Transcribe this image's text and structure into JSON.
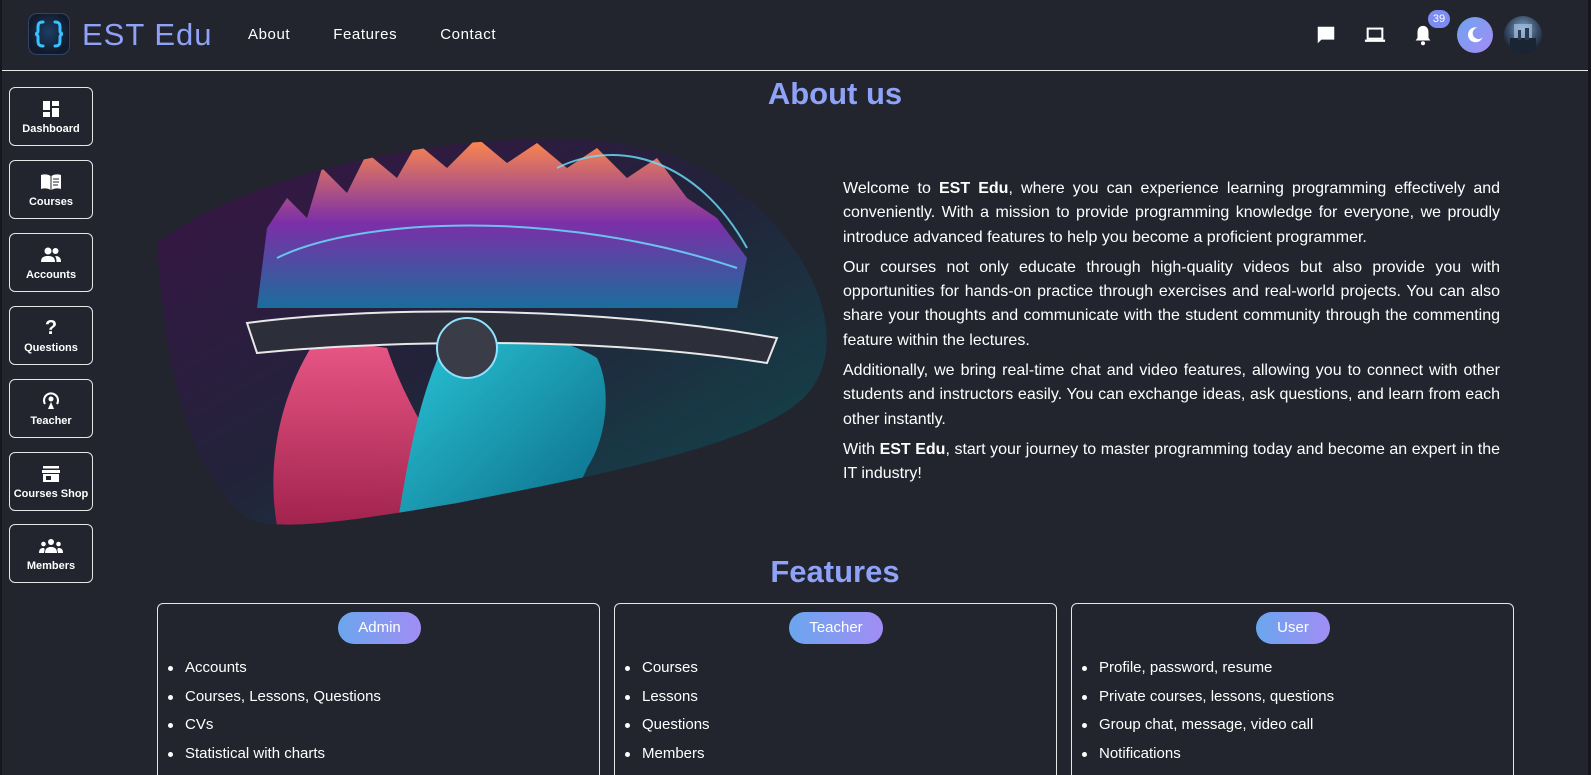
{
  "header": {
    "brand": "EST Edu",
    "nav": [
      "About",
      "Features",
      "Contact"
    ],
    "notification_count": "39",
    "icons": [
      "chat-icon",
      "laptop-icon",
      "bell-icon",
      "moon-icon",
      "avatar"
    ]
  },
  "sidebar": {
    "items": [
      {
        "label": "Dashboard",
        "icon": "dashboard-icon"
      },
      {
        "label": "Courses",
        "icon": "book-icon"
      },
      {
        "label": "Accounts",
        "icon": "people-icon"
      },
      {
        "label": "Questions",
        "icon": "question-icon"
      },
      {
        "label": "Teacher",
        "icon": "teacher-icon"
      },
      {
        "label": "Courses Shop",
        "icon": "store-icon"
      },
      {
        "label": "Members",
        "icon": "groups-icon"
      }
    ]
  },
  "about": {
    "title": "About us",
    "p1_prefix": "Welcome to ",
    "brand": "EST Edu",
    "p1_suffix": ", where you can experience learning programming effectively and conveniently. With a mission to provide programming knowledge for everyone, we proudly introduce advanced features to help you become a proficient programmer.",
    "p2": "Our courses not only educate through high-quality videos but also provide you with opportunities for hands-on practice through exercises and real-world projects. You can also share your thoughts and communicate with the student community through the commenting feature within the lectures.",
    "p3": "Additionally, we bring real-time chat and video features, allowing you to connect with other students and instructors easily. You can exchange ideas, ask questions, and learn from each other instantly.",
    "p4_prefix": "With ",
    "p4_suffix": ", start your journey to master programming today and become an expert in the IT industry!"
  },
  "features": {
    "title": "Features",
    "cards": [
      {
        "role": "Admin",
        "items": [
          "Accounts",
          "Courses, Lessons, Questions",
          "CVs",
          "Statistical with charts"
        ]
      },
      {
        "role": "Teacher",
        "items": [
          "Courses",
          "Lessons",
          "Questions",
          "Members"
        ]
      },
      {
        "role": "User",
        "items": [
          "Profile, password, resume",
          "Private courses, lessons, questions",
          "Group chat, message, video call",
          "Notifications"
        ]
      }
    ]
  },
  "colors": {
    "background": "#22252e",
    "accent": "#8fa2f7",
    "pill_gradient_start": "#6aa6ee",
    "pill_gradient_end": "#a18df4"
  }
}
